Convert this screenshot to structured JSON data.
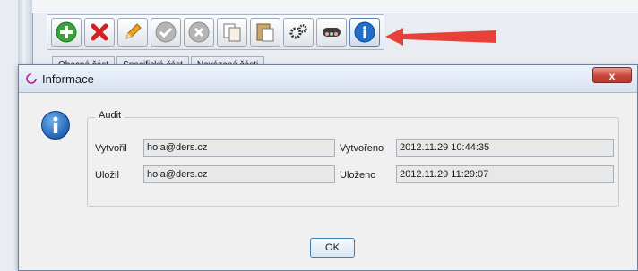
{
  "background_app": {
    "tabs": [
      "Obecná část",
      "Specifická část",
      "Navázané části"
    ],
    "toolbar": {
      "buttons": [
        {
          "name": "add",
          "icon": "plus-icon",
          "color": "#3aa339"
        },
        {
          "name": "delete",
          "icon": "delete-x-icon",
          "color": "#d42020"
        },
        {
          "name": "edit",
          "icon": "pencil-icon",
          "color": "#f0a020"
        },
        {
          "name": "confirm",
          "icon": "check-icon",
          "color": "#a8a8a8"
        },
        {
          "name": "cancel",
          "icon": "cancel-icon",
          "color": "#a8a8a8"
        },
        {
          "name": "copy",
          "icon": "copy-icon",
          "color": "#c9a86b"
        },
        {
          "name": "paste",
          "icon": "paste-icon",
          "color": "#c9a86b"
        },
        {
          "name": "settings",
          "icon": "gears-icon",
          "color": "#333333"
        },
        {
          "name": "users",
          "icon": "users-icon",
          "color": "#444444"
        },
        {
          "name": "info",
          "icon": "info-icon",
          "color": "#1f6fc9"
        }
      ]
    },
    "arrow_color": "#e8413a"
  },
  "dialog": {
    "title": "Informace",
    "close_label": "x",
    "group_title": "Audit",
    "fields": {
      "vytvoril_label": "Vytvořil",
      "vytvoril_value": "hola@ders.cz",
      "vytvoreno_label": "Vytvořeno",
      "vytvoreno_value": "2012.11.29 10:44:35",
      "ulozil_label": "Uložil",
      "ulozil_value": "hola@ders.cz",
      "ulozeno_label": "Uloženo",
      "ulozeno_value": "2012.11.29 11:29:07"
    },
    "ok_label": "OK"
  }
}
